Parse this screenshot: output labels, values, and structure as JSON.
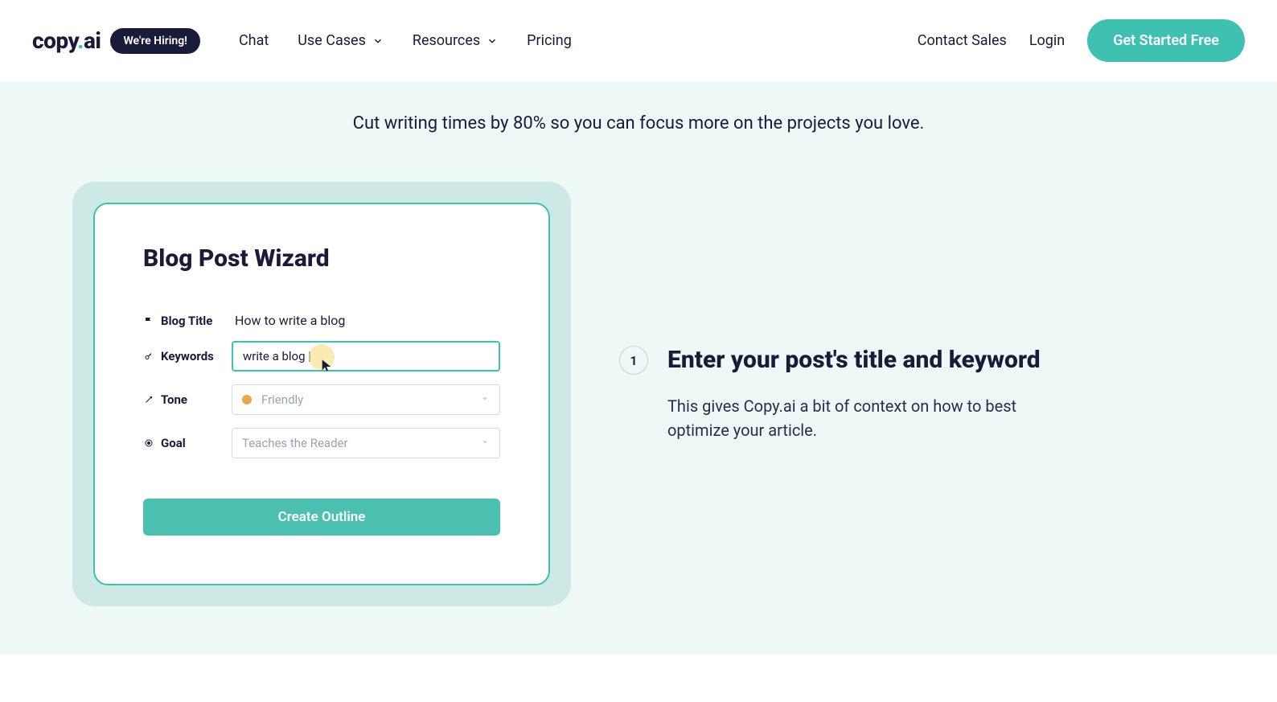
{
  "header": {
    "logo_main": "copy",
    "logo_dot": ".",
    "logo_suffix": "ai",
    "hiring_label": "We're Hiring!",
    "nav": {
      "chat": "Chat",
      "use_cases": "Use Cases",
      "resources": "Resources",
      "pricing": "Pricing"
    },
    "right": {
      "contact": "Contact Sales",
      "login": "Login",
      "cta": "Get Started Free"
    }
  },
  "tagline": "Cut writing times by 80% so you can focus more on the projects you love.",
  "wizard": {
    "title": "Blog Post Wizard",
    "rows": {
      "blog_title": {
        "label": "Blog Title",
        "value": "How to write a blog"
      },
      "keywords": {
        "label": "Keywords",
        "value": "write a blog |"
      },
      "tone": {
        "label": "Tone",
        "placeholder": "Friendly"
      },
      "goal": {
        "label": "Goal",
        "placeholder": "Teaches the Reader"
      }
    },
    "create_label": "Create Outline"
  },
  "step": {
    "number": "1",
    "title": "Enter your post's title and keyword",
    "desc": "This gives Copy.ai a bit of context on how to best optimize your article."
  }
}
